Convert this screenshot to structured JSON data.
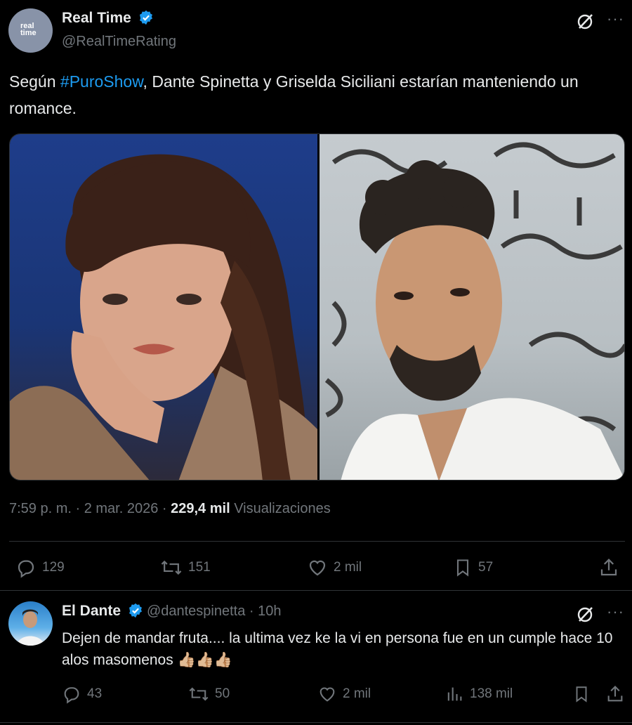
{
  "tweet": {
    "author_name": "Real Time",
    "author_handle": "@RealTimeRating",
    "avatar_text": [
      "real",
      "time"
    ],
    "text_before": "Según ",
    "hashtag": "#PuroShow",
    "text_after": ", Dante Spinetta y Griselda Siciliani estarían manteniendo un romance.",
    "meta": {
      "time": "7:59 p. m.",
      "sep1": " · ",
      "date": "2 mar. 2026",
      "sep2": " · ",
      "views": "229,4 mil",
      "views_label": " Visualizaciones"
    },
    "actions": {
      "replies": "129",
      "retweets": "151",
      "likes": "2 mil",
      "bookmarks": "57"
    },
    "more_label": "···"
  },
  "reply": {
    "author_name": "El Dante",
    "author_handle": "@dantespinetta",
    "sep": " · ",
    "age": "10h",
    "text": "Dejen de mandar fruta.... la ultima vez ke la vi en persona fue en un cumple hace 10 alos masomenos 👍🏼👍🏼👍🏼",
    "actions": {
      "replies": "43",
      "retweets": "50",
      "likes": "2 mil",
      "views": "138 mil"
    },
    "more_label": "···"
  },
  "colors": {
    "accent": "#1d9bf0",
    "muted": "#71767b",
    "text": "#e7e9ea",
    "background": "#000000"
  }
}
